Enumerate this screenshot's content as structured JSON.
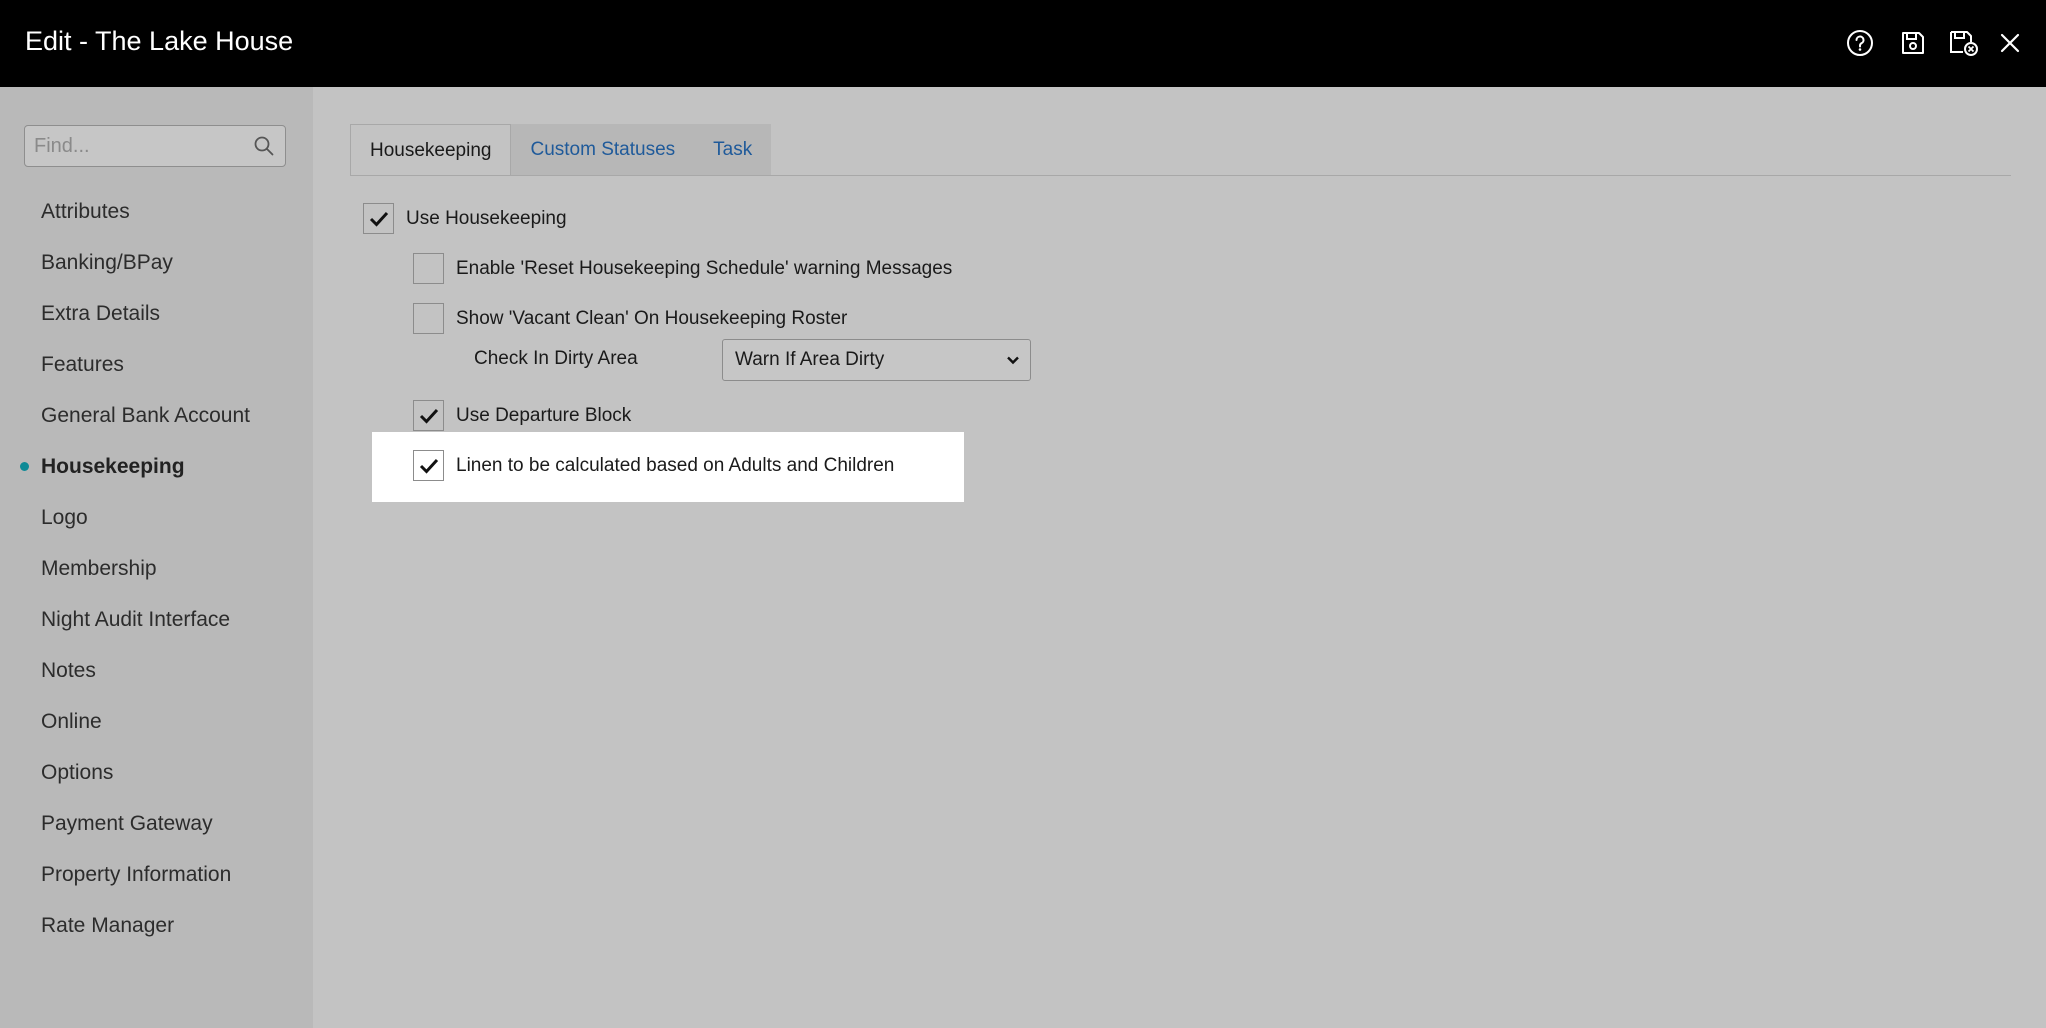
{
  "window": {
    "title": "Edit - The Lake House",
    "icons": [
      "help-icon",
      "save-icon",
      "save-and-close-icon",
      "close-icon"
    ]
  },
  "sidebar": {
    "search_placeholder": "Find...",
    "items": [
      {
        "label": "Attributes"
      },
      {
        "label": "Banking/BPay"
      },
      {
        "label": "Extra Details"
      },
      {
        "label": "Features"
      },
      {
        "label": "General Bank Account"
      },
      {
        "label": "Housekeeping",
        "active": true
      },
      {
        "label": "Logo"
      },
      {
        "label": "Membership"
      },
      {
        "label": "Night Audit Interface"
      },
      {
        "label": "Notes"
      },
      {
        "label": "Online"
      },
      {
        "label": "Options"
      },
      {
        "label": "Payment Gateway"
      },
      {
        "label": "Property Information"
      },
      {
        "label": "Rate Manager"
      }
    ],
    "active_color": "#0e8a96"
  },
  "tabs": [
    {
      "label": "Housekeeping",
      "active": true
    },
    {
      "label": "Custom Statuses",
      "active": false
    },
    {
      "label": "Task",
      "active": false
    }
  ],
  "settings": {
    "use_housekeeping": {
      "label": "Use Housekeeping",
      "checked": true
    },
    "enable_reset_warning": {
      "label": "Enable 'Reset Housekeeping Schedule' warning Messages",
      "checked": false
    },
    "show_vacant_clean": {
      "label": "Show 'Vacant Clean' On Housekeeping Roster",
      "checked": false
    },
    "check_in_dirty_area": {
      "label": "Check In Dirty Area",
      "value": "Warn If Area Dirty"
    },
    "use_departure_block": {
      "label": "Use Departure Block",
      "checked": true
    },
    "linen_calculation": {
      "label": "Linen to be calculated based on Adults and Children",
      "checked": true
    }
  },
  "colors": {
    "titlebar": "#000000",
    "link_tab": "#1f5a9a",
    "highlight": "#ffffff"
  }
}
